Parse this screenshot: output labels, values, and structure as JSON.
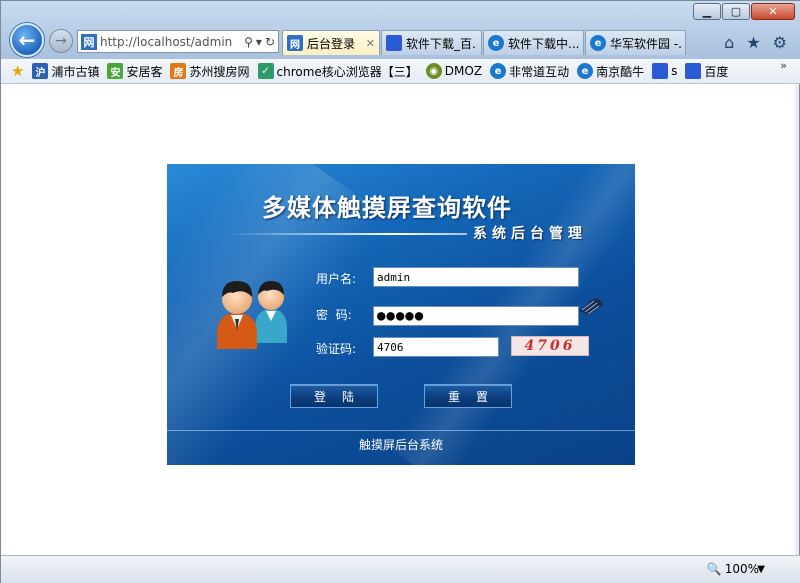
{
  "browser": {
    "address_url": "http://localhost/admin",
    "address_favicon": "网",
    "tabs": [
      {
        "label": "后台登录",
        "icon": "网",
        "icon_color": "#2f6fc2",
        "active": true
      },
      {
        "label": "软件下载_百...",
        "icon": "baidu-paw-icon",
        "icon_color": "#2e58d6",
        "active": false
      },
      {
        "label": "软件下载中...",
        "icon": "ie-icon",
        "icon_color": "#1b78d0",
        "active": false
      },
      {
        "label": "华军软件园 -...",
        "icon": "ie-icon",
        "icon_color": "#1b78d0",
        "active": false
      }
    ],
    "zoom": "100%"
  },
  "favorites": [
    {
      "label": "浦市古镇",
      "icon": "沪",
      "color": "#2a62b4"
    },
    {
      "label": "安居客",
      "icon": "安",
      "color": "#4ca63a"
    },
    {
      "label": "苏州搜房网",
      "icon": "房",
      "color": "#e07b19"
    },
    {
      "label": "chrome核心浏览器【三】",
      "icon": "leaf-icon",
      "color": "#2e9a6a"
    },
    {
      "label": "DMOZ",
      "icon": "dmoz-icon",
      "color": "#6b8e23"
    },
    {
      "label": "非常道互动",
      "icon": "ie-icon",
      "color": "#1b78d0"
    },
    {
      "label": "南京酷牛",
      "icon": "ie-icon",
      "color": "#1b78d0"
    },
    {
      "label": "s",
      "icon": "baidu-paw-icon",
      "color": "#2e58d6"
    },
    {
      "label": "百度",
      "icon": "baidu-paw-icon",
      "color": "#2e58d6"
    }
  ],
  "login": {
    "title": "多媒体触摸屏查询软件",
    "subtitle": "系统后台管理",
    "username_label": "用户名:",
    "username_value": "admin",
    "password_label": "密  码:",
    "password_dots": "●●●●●",
    "captcha_label": "验证码:",
    "captcha_value": "4706",
    "captcha_image_text": "4706",
    "login_button": "登陆",
    "reset_button": "重置",
    "footer": "触摸屏后台系统"
  }
}
